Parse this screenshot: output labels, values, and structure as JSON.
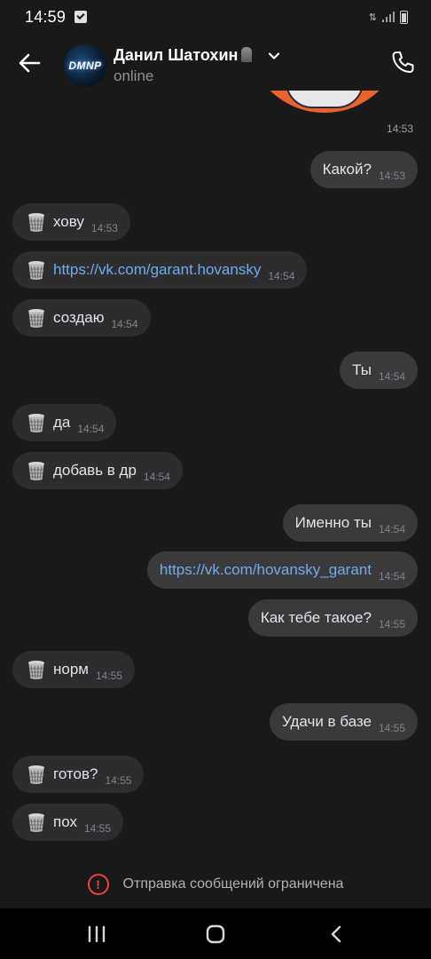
{
  "status_bar": {
    "time": "14:59",
    "icons": [
      "notification-check-icon",
      "data-arrows-icon",
      "signal-icon",
      "battery-icon"
    ]
  },
  "header": {
    "contact_name": "Данил Шатохин",
    "avatar_text": "DMNP",
    "status": "online"
  },
  "image_remnant": {
    "time": "14:53"
  },
  "messages": [
    {
      "dir": "out",
      "text": "Какой?",
      "time": "14:53",
      "link": false,
      "icon": null
    },
    {
      "dir": "in",
      "text": "хову",
      "time": "14:53",
      "link": false,
      "icon": "wastebasket-icon"
    },
    {
      "dir": "in",
      "text": "https://vk.com/garant.hovansky",
      "time": "14:54",
      "link": true,
      "icon": "wastebasket-icon"
    },
    {
      "dir": "in",
      "text": "создаю",
      "time": "14:54",
      "link": false,
      "icon": "wastebasket-icon"
    },
    {
      "dir": "out",
      "text": "Ты",
      "time": "14:54",
      "link": false,
      "icon": null
    },
    {
      "dir": "in",
      "text": "да",
      "time": "14:54",
      "link": false,
      "icon": "wastebasket-icon"
    },
    {
      "dir": "in",
      "text": "добавь в др",
      "time": "14:54",
      "link": false,
      "icon": "wastebasket-icon"
    },
    {
      "dir": "out",
      "text": "Именно ты",
      "time": "14:54",
      "link": false,
      "icon": null
    },
    {
      "dir": "out",
      "text": "https://vk.com/hovansky_garant",
      "time": "14:54",
      "link": true,
      "icon": null
    },
    {
      "dir": "out",
      "text": "Как тебе такое?",
      "time": "14:55",
      "link": false,
      "icon": null
    },
    {
      "dir": "in",
      "text": "норм",
      "time": "14:55",
      "link": false,
      "icon": "wastebasket-icon"
    },
    {
      "dir": "out",
      "text": "Удачи в базе",
      "time": "14:55",
      "link": false,
      "icon": null
    },
    {
      "dir": "in",
      "text": "готов?",
      "time": "14:55",
      "link": false,
      "icon": "wastebasket-icon"
    },
    {
      "dir": "in",
      "text": "пох",
      "time": "14:55",
      "link": false,
      "icon": "wastebasket-icon"
    }
  ],
  "restriction": {
    "text": "Отправка сообщений ограничена",
    "color": "#e64646"
  },
  "colors": {
    "background": "#191919",
    "incoming_bubble": "#2d2d2f",
    "outgoing_bubble": "#3a3a3c",
    "link": "#71aaeb",
    "nav_bar": "#000000"
  },
  "nav_bar": {
    "buttons": [
      "recent-apps-icon",
      "home-icon",
      "back-icon"
    ]
  }
}
